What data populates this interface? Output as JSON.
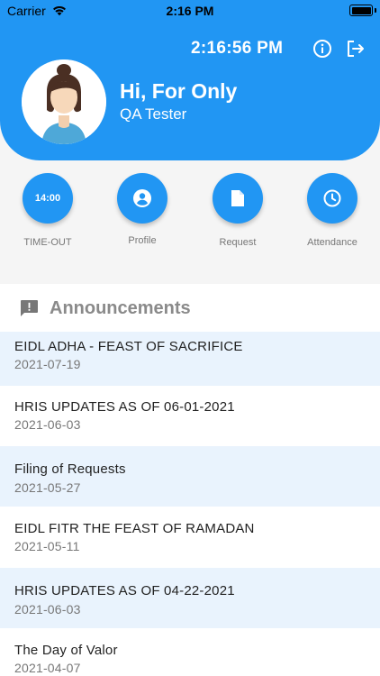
{
  "status_bar": {
    "carrier": "Carrier",
    "time": "2:16 PM"
  },
  "header": {
    "clock": "2:16:56 PM",
    "greeting": "Hi, For Only",
    "role": "QA Tester",
    "color": "#2196f3"
  },
  "quick_actions": [
    {
      "label": "TIME-OUT",
      "badge": "14:00",
      "icon": "time-badge"
    },
    {
      "label": "Profile",
      "icon": "account-circle-icon"
    },
    {
      "label": "Request",
      "icon": "document-icon"
    },
    {
      "label": "Attendance",
      "icon": "clock-icon"
    }
  ],
  "announcements": {
    "title": "Announcements",
    "items": [
      {
        "title": "EIDL ADHA - FEAST OF SACRIFICE",
        "date": "2021-07-19"
      },
      {
        "title": "HRIS UPDATES AS OF 06-01-2021",
        "date": "2021-06-03"
      },
      {
        "title": "Filing of Requests",
        "date": "2021-05-27"
      },
      {
        "title": "EIDL FITR THE FEAST OF RAMADAN",
        "date": "2021-05-11"
      },
      {
        "title": "HRIS UPDATES AS OF 04-22-2021",
        "date": "2021-06-03"
      },
      {
        "title": "The Day of Valor",
        "date": "2021-04-07"
      }
    ]
  }
}
